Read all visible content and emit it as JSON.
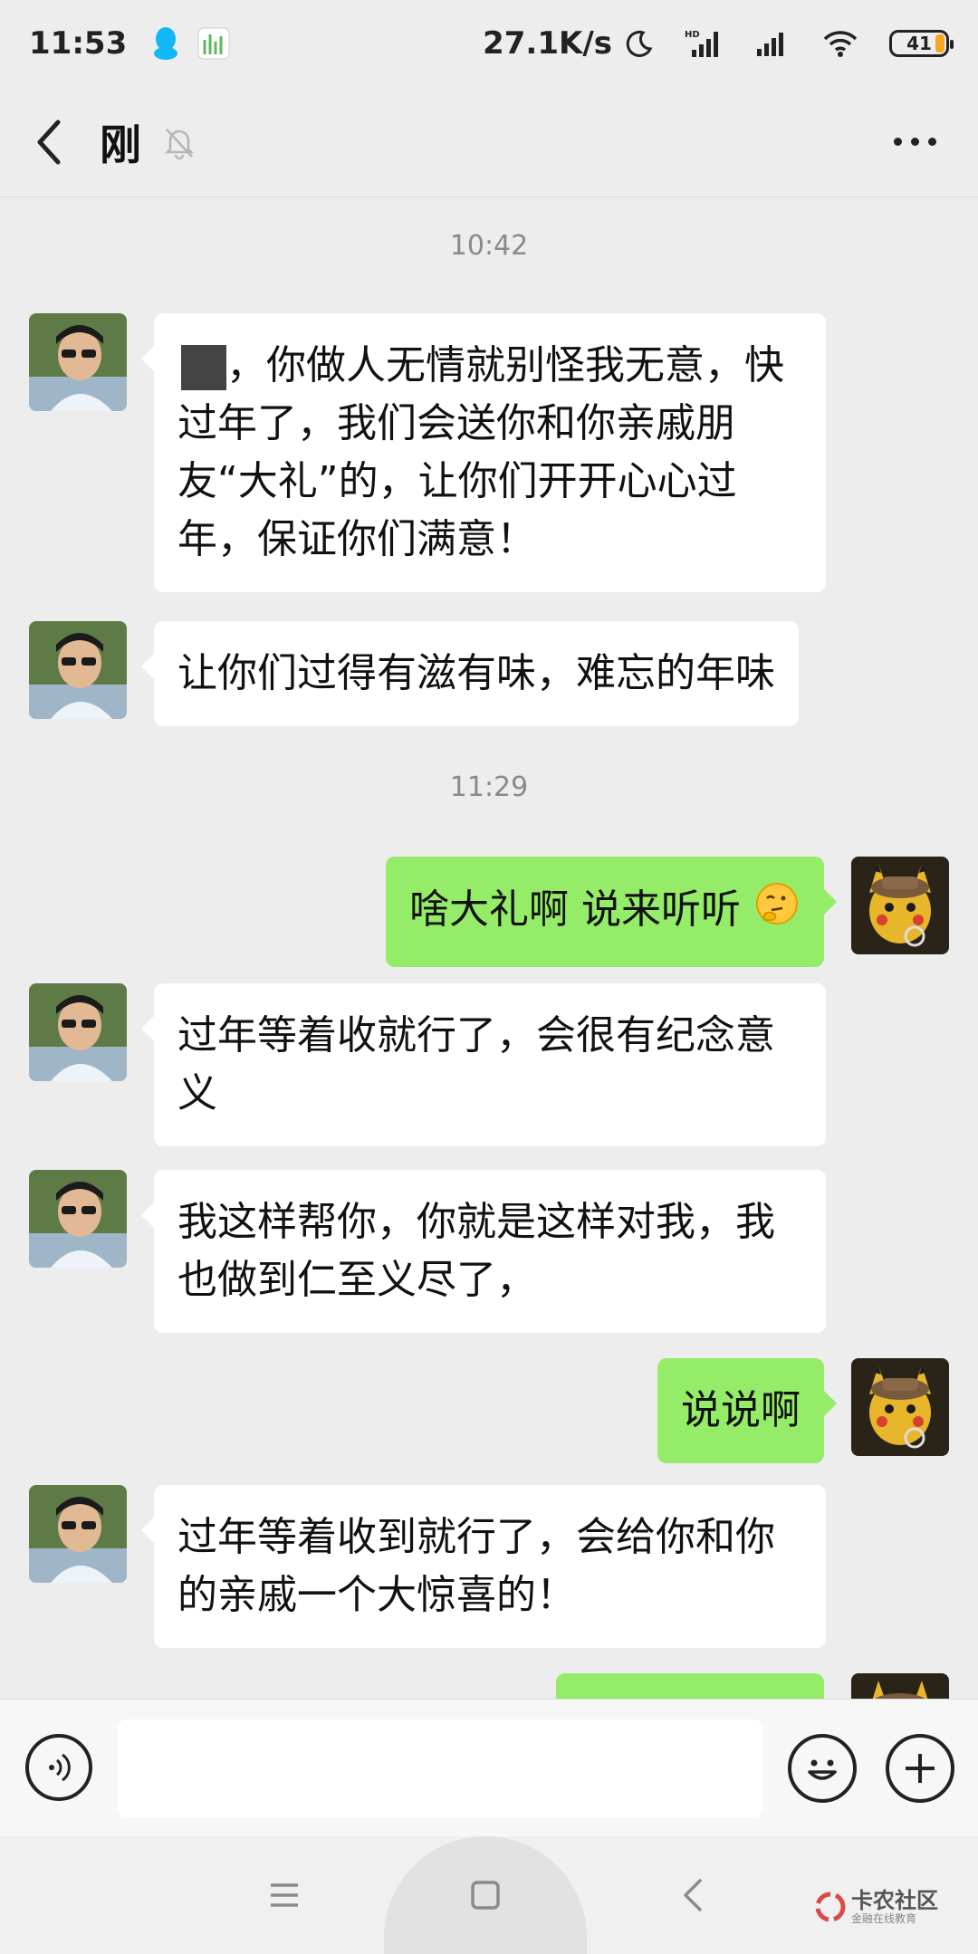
{
  "status_bar": {
    "time": "11:53",
    "net_speed": "27.1K/s",
    "battery": "41",
    "battery_fraction": 0.41
  },
  "header": {
    "title": "刚"
  },
  "messages": [
    {
      "type": "timestamp",
      "text": "10:42"
    },
    {
      "type": "in",
      "text_prefix": "",
      "text": "，你做人无情就别怪我无意，快过年了，我们会送你和你亲戚朋友“大礼”的，让你们开开心心过年，保证你们满意！"
    },
    {
      "type": "in",
      "text": "让你们过得有滋有味，难忘的年味"
    },
    {
      "type": "timestamp",
      "text": "11:29"
    },
    {
      "type": "out",
      "text": "啥大礼啊 说来听听",
      "emoji": "thinking-face"
    },
    {
      "type": "in",
      "text": "过年等着收就行了，会很有纪念意义"
    },
    {
      "type": "in",
      "text": "我这样帮你，你就是这样对我，我也做到仁至义尽了，"
    },
    {
      "type": "out",
      "text": "说说啊"
    },
    {
      "type": "in",
      "text": "过年等着收到就行了，会给你和你的亲戚一个大惊喜的！"
    }
  ],
  "input": {
    "value": "",
    "placeholder": ""
  },
  "watermark": {
    "title": "卡农社区",
    "subtitle": "金融在线教育"
  },
  "colors": {
    "background": "#ededed",
    "outgoing_bubble": "#95ec69",
    "incoming_bubble": "#ffffff",
    "battery": "#f5a623"
  }
}
